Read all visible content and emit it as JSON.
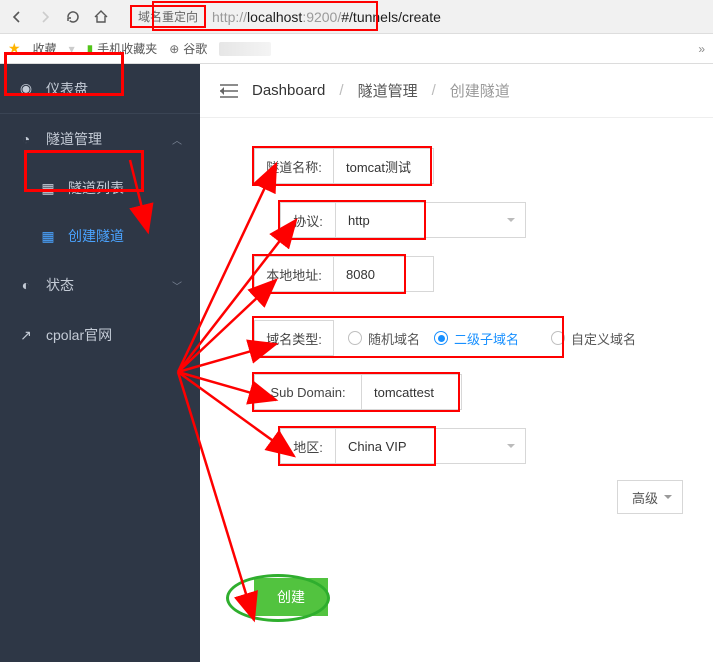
{
  "browser": {
    "redirect_tag": "域名重定向",
    "url_gray1": "http://",
    "url_host": "localhost",
    "url_gray2": ":9200/",
    "url_path": "#/tunnels/create"
  },
  "bookmarks": {
    "fav": "收藏",
    "mobile": "手机收藏夹",
    "google": "谷歌"
  },
  "sidebar": {
    "items": [
      {
        "label": "仪表盘"
      },
      {
        "label": "隧道管理"
      },
      {
        "label": "隧道列表"
      },
      {
        "label": "创建隧道"
      },
      {
        "label": "状态"
      },
      {
        "label": "cpolar官网"
      }
    ]
  },
  "breadcrumb": {
    "dash": "Dashboard",
    "mid": "隧道管理",
    "last": "创建隧道"
  },
  "form": {
    "name_lbl": "隧道名称:",
    "name_val": "tomcat测试",
    "proto_lbl": "协议:",
    "proto_val": "http",
    "local_lbl": "本地地址:",
    "local_val": "8080",
    "domaintype_lbl": "域名类型:",
    "radio_random": "随机域名",
    "radio_sub": "二级子域名",
    "radio_custom": "自定义域名",
    "subdom_lbl": "Sub Domain:",
    "subdom_val": "tomcattest",
    "region_lbl": "地区:",
    "region_val": "China VIP",
    "advanced": "高级",
    "create": "创建"
  }
}
